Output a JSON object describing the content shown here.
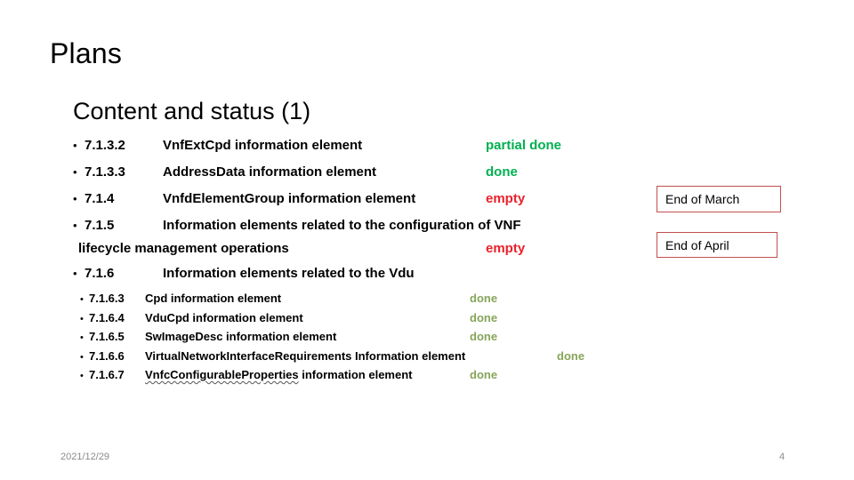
{
  "slide": {
    "title": "Plans",
    "subtitle": "Content and status (1)",
    "bullet_glyph": "•"
  },
  "colors": {
    "status_done": "#00B050",
    "status_empty": "#E8212B",
    "status_done_muted": "#87A559",
    "callout_border": "#C0504D",
    "footer_text": "#8A8A8A",
    "body_text": "#000000"
  },
  "outline": {
    "items": [
      {
        "number": "7.1.3.2",
        "text": "VnfExtCpd information element",
        "status": "partial done",
        "status_color": "#00B050",
        "wrapped_text": "",
        "status_on_wrap": false
      },
      {
        "number": "7.1.3.3",
        "text": "AddressData information element",
        "status": "done",
        "status_color": "#00B050",
        "wrapped_text": "",
        "status_on_wrap": false
      },
      {
        "number": "7.1.4",
        "text": "VnfdElementGroup information element",
        "status": "empty",
        "status_color": "#E8212B",
        "wrapped_text": "",
        "status_on_wrap": false
      },
      {
        "number": "7.1.5",
        "text": "Information elements related to the configuration of VNF",
        "wrapped_text": "lifecycle management operations",
        "status": "empty",
        "status_color": "#E8212B",
        "status_on_wrap": true
      },
      {
        "number": "7.1.6",
        "text": "Information elements related to the Vdu",
        "status": "",
        "status_color": "#00B050",
        "wrapped_text": "",
        "status_on_wrap": false
      }
    ],
    "subitems": [
      {
        "number": "7.1.6.3",
        "text": "Cpd information element",
        "status": "done",
        "status_color": "#87A559",
        "status_far": false,
        "spellcheck_word": ""
      },
      {
        "number": "7.1.6.4",
        "text": "VduCpd information element",
        "status": "done",
        "status_color": "#87A559",
        "status_far": false,
        "spellcheck_word": ""
      },
      {
        "number": "7.1.6.5",
        "text": "SwImageDesc information element",
        "status": "done",
        "status_color": "#87A559",
        "status_far": false,
        "spellcheck_word": ""
      },
      {
        "number": "7.1.6.6",
        "text": "VirtualNetworkInterfaceRequirements Information element",
        "status": "done",
        "status_color": "#87A559",
        "status_far": true,
        "spellcheck_word": ""
      },
      {
        "number": "7.1.6.7",
        "text": " information element",
        "status": "done",
        "status_color": "#87A559",
        "status_far": false,
        "spellcheck_word": "VnfcConfigurableProperties"
      }
    ]
  },
  "callouts": {
    "march": "End of March",
    "april": "End of April"
  },
  "footer": {
    "date": "2021/12/29",
    "page_number": "4"
  }
}
